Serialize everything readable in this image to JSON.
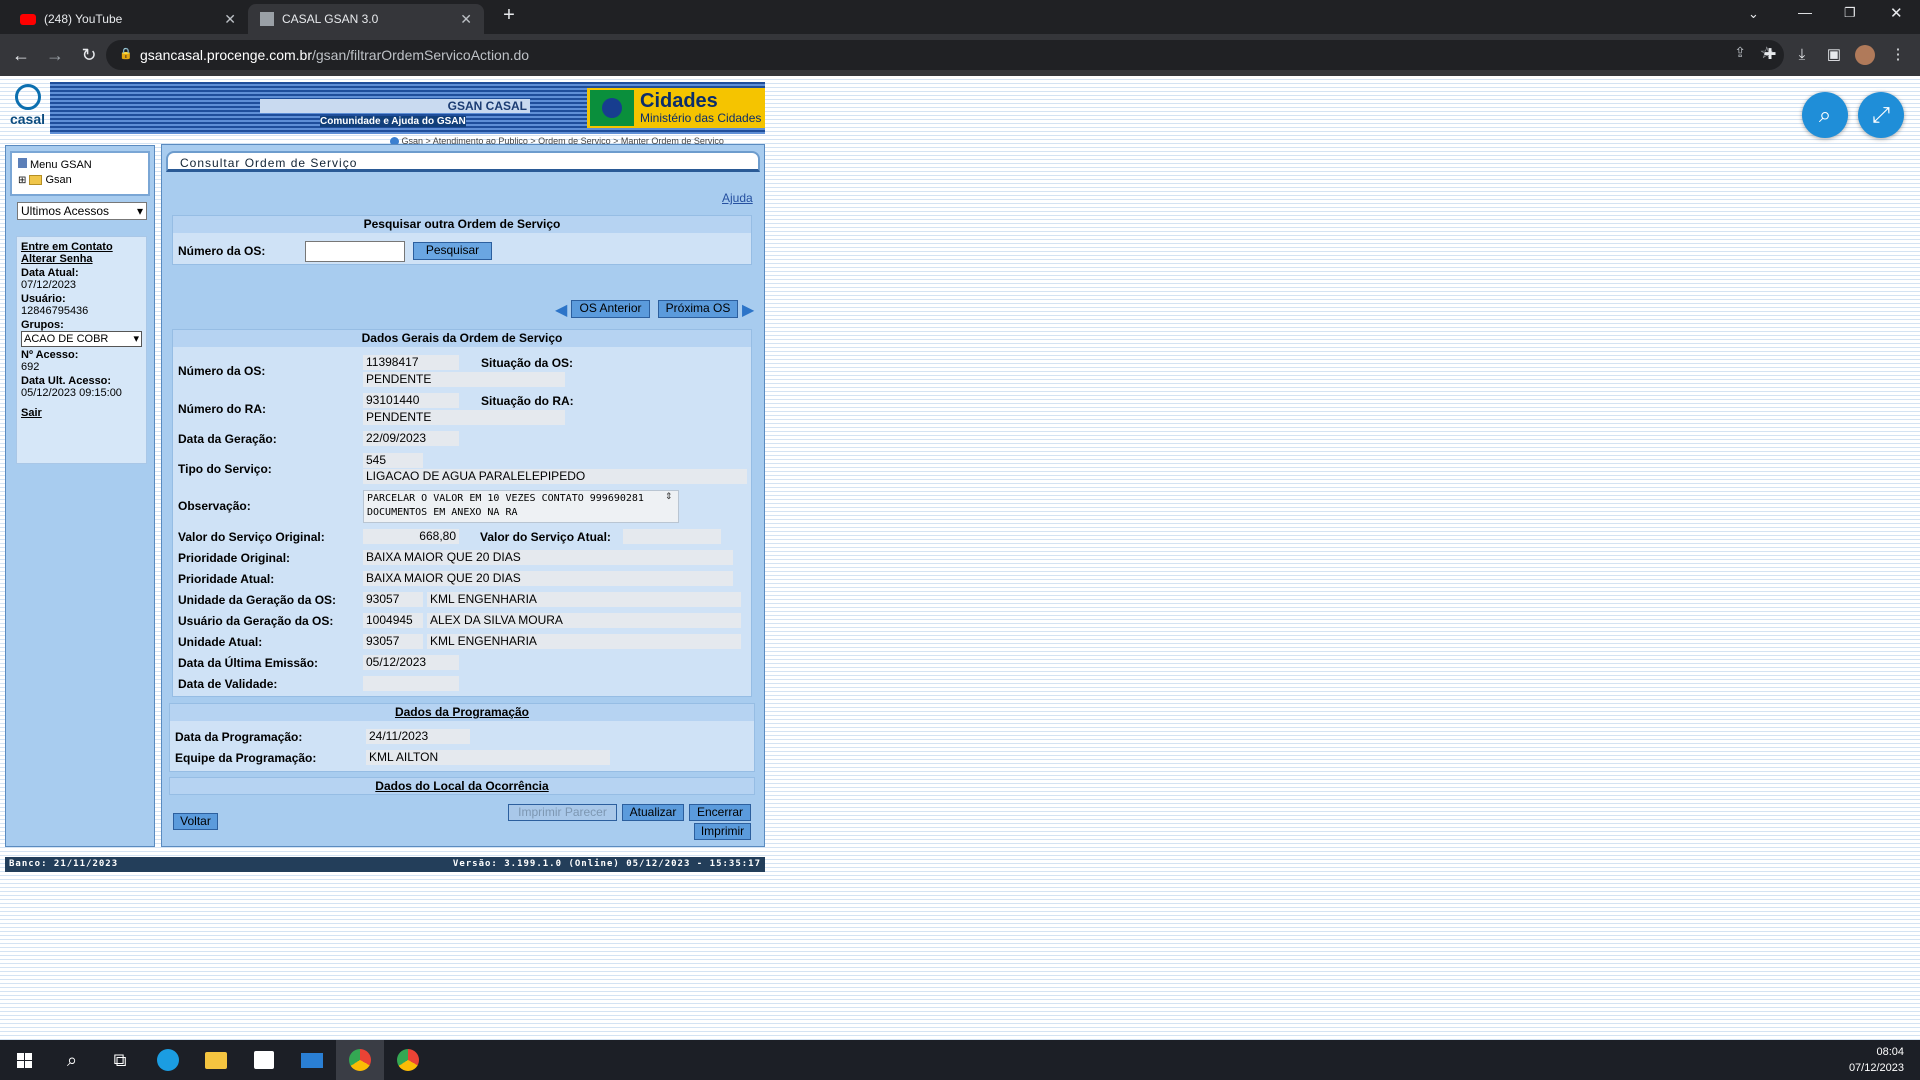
{
  "browser": {
    "tabs": [
      {
        "title": "(248) YouTube"
      },
      {
        "title": "CASAL GSAN 3.0"
      }
    ],
    "url_host": "gsancasal.procenge.com.br",
    "url_path": "/gsan/filtrarOrdemServicoAction.do"
  },
  "header": {
    "logo_text": "casal",
    "system_name": "GSAN CASAL",
    "community_link": "Comunidade e Ajuda do GSAN",
    "ministry_title": "Cidades",
    "ministry_subtitle": "Ministério das Cidades",
    "breadcrumb": "Gsan > Atendimento ao Publico > Ordem de Servico > Manter Ordem de Servico"
  },
  "sidebar": {
    "menu_title": "Menu GSAN",
    "menu_root": "Gsan",
    "recent_select": "Ultimos Acessos",
    "contact_link": "Entre em Contato",
    "change_password_link": "Alterar Senha",
    "current_date_label": "Data Atual:",
    "current_date": "07/12/2023",
    "user_label": "Usuário:",
    "user": "12846795436",
    "groups_label": "Grupos:",
    "group_selected": "ACAO DE COBR",
    "access_count_label": "Nº Acesso:",
    "access_count": "692",
    "last_access_label": "Data Ult. Acesso:",
    "last_access": "05/12/2023 09:15:00",
    "logout_link": "Sair"
  },
  "main": {
    "title": "Consultar Ordem de Serviço",
    "help_link": "Ajuda",
    "search": {
      "heading": "Pesquisar outra Ordem de Serviço",
      "os_label": "Número da OS:",
      "os_value": "",
      "search_button": "Pesquisar"
    },
    "nav": {
      "prev": "OS Anterior",
      "next": "Próxima OS"
    },
    "general": {
      "heading": "Dados Gerais da Ordem de Serviço",
      "os_number_label": "Número da OS:",
      "os_number": "11398417",
      "os_status_label": "Situação da OS:",
      "os_status": "PENDENTE",
      "ra_number_label": "Número do RA:",
      "ra_number": "93101440",
      "ra_status_label": "Situação do RA:",
      "ra_status": "PENDENTE",
      "generation_date_label": "Data da Geração:",
      "generation_date": "22/09/2023",
      "service_type_label": "Tipo do Serviço:",
      "service_type_code": "545",
      "service_type_desc": "LIGACAO DE AGUA PARALELEPIPEDO",
      "observation_label": "Observação:",
      "observation": "PARCELAR O VALOR EM 10 VEZES CONTATO 999690281 DOCUMENTOS EM ANEXO NA RA",
      "original_value_label": "Valor do Serviço Original:",
      "original_value": "668,80",
      "current_value_label": "Valor do Serviço Atual:",
      "current_value": "",
      "original_priority_label": "Prioridade Original:",
      "original_priority": "BAIXA MAIOR QUE 20 DIAS",
      "current_priority_label": "Prioridade Atual:",
      "current_priority": "BAIXA MAIOR QUE 20 DIAS",
      "gen_unit_label": "Unidade da Geração da OS:",
      "gen_unit_code": "93057",
      "gen_unit_name": "KML ENGENHARIA",
      "gen_user_label": "Usuário da Geração da OS:",
      "gen_user_code": "1004945",
      "gen_user_name": "ALEX DA SILVA MOURA",
      "current_unit_label": "Unidade Atual:",
      "current_unit_code": "93057",
      "current_unit_name": "KML ENGENHARIA",
      "last_emission_label": "Data da Última Emissão:",
      "last_emission": "05/12/2023",
      "validity_label": "Data de Validade:",
      "validity": ""
    },
    "programming": {
      "heading": "Dados da Programação",
      "date_label": "Data da Programação:",
      "date": "24/11/2023",
      "team_label": "Equipe da Programação:",
      "team": "KML AILTON"
    },
    "location_heading": "Dados do Local da Ocorrência",
    "buttons": {
      "back": "Voltar",
      "print_opinion": "Imprimir Parecer",
      "update": "Atualizar",
      "close": "Encerrar",
      "print": "Imprimir"
    }
  },
  "footer": {
    "bank": "Banco: 21/11/2023",
    "version": "Versão: 3.199.1.0 (Online) 05/12/2023 - 15:35:17"
  },
  "taskbar": {
    "time": "08:04",
    "date": "07/12/2023"
  }
}
